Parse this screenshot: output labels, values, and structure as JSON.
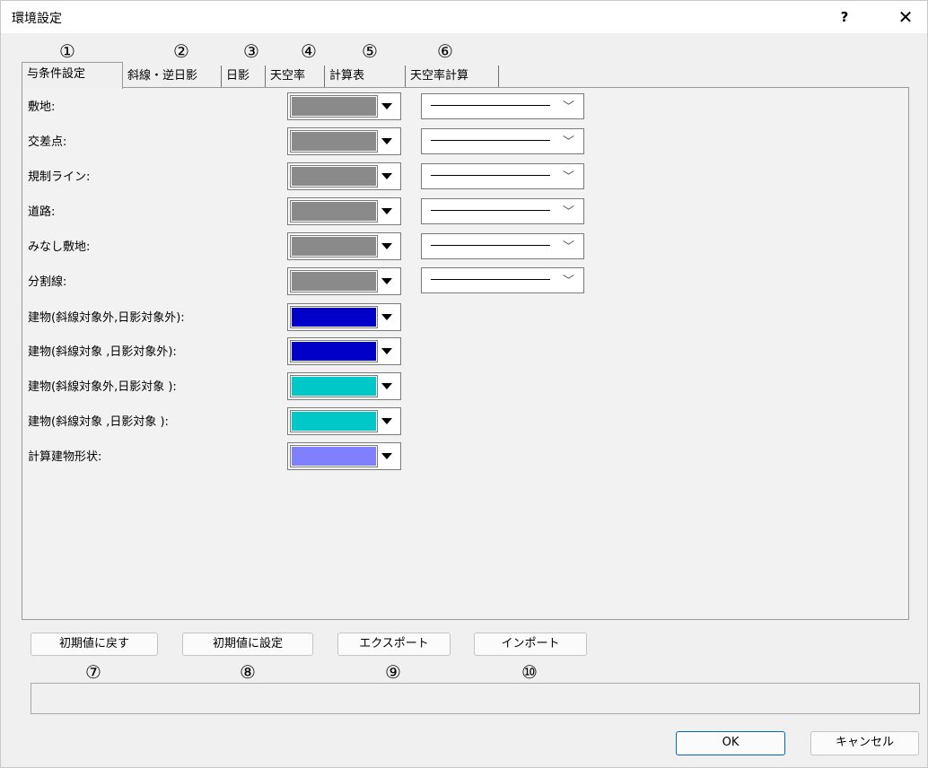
{
  "window": {
    "title": "環境設定",
    "help": "?",
    "close": "✕"
  },
  "annotations": {
    "tab1": "①",
    "tab2": "②",
    "tab3": "③",
    "tab4": "④",
    "tab5": "⑤",
    "tab6": "⑥",
    "btn1": "⑦",
    "btn2": "⑧",
    "btn3": "⑨",
    "btn4": "⑩"
  },
  "tabs": [
    {
      "label": "与条件設定"
    },
    {
      "label": "斜線・逆日影"
    },
    {
      "label": "日影"
    },
    {
      "label": "天空率"
    },
    {
      "label": "計算表"
    },
    {
      "label": "天空率計算"
    }
  ],
  "rows": [
    {
      "label": "敷地:",
      "color": "#8a8a8a"
    },
    {
      "label": "交差点:",
      "color": "#8a8a8a"
    },
    {
      "label": "規制ライン:",
      "color": "#8a8a8a"
    },
    {
      "label": "道路:",
      "color": "#8a8a8a"
    },
    {
      "label": "みなし敷地:",
      "color": "#8a8a8a"
    },
    {
      "label": "分割線:",
      "color": "#8a8a8a"
    },
    {
      "label": "建物(斜線対象外,日影対象外):",
      "color": "#0000c8"
    },
    {
      "label": "建物(斜線対象 ,日影対象外):",
      "color": "#0000c8"
    },
    {
      "label": "建物(斜線対象外,日影対象 ):",
      "color": "#00c8c8"
    },
    {
      "label": "建物(斜線対象 ,日影対象 ):",
      "color": "#00c8c8"
    },
    {
      "label": "計算建物形状:",
      "color": "#8080ff"
    }
  ],
  "buttons": {
    "reset": "初期値に戻す",
    "set_default": "初期値に設定",
    "export": "エクスポート",
    "import": "インポート",
    "ok": "OK",
    "cancel": "キャンセル"
  }
}
